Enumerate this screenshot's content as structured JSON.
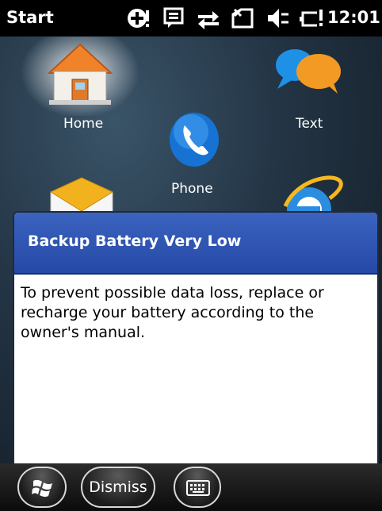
{
  "status_bar": {
    "title": "Start",
    "time": "12:01",
    "icons": [
      "notification-plus-icon",
      "message-icon",
      "sync-arrows-icon",
      "signal-icon",
      "speaker-muted-icon",
      "battery-low-icon"
    ]
  },
  "home_tiles": {
    "home_label": "Home",
    "text_label": "Text",
    "phone_label": "Phone"
  },
  "dialog": {
    "title": "Backup Battery Very Low",
    "body": "To prevent possible data loss, replace or recharge your battery according to the owner's manual."
  },
  "taskbar": {
    "dismiss_label": "Dismiss"
  },
  "colors": {
    "dialog_header": "#2a4fae",
    "taskbar": "#111111"
  }
}
